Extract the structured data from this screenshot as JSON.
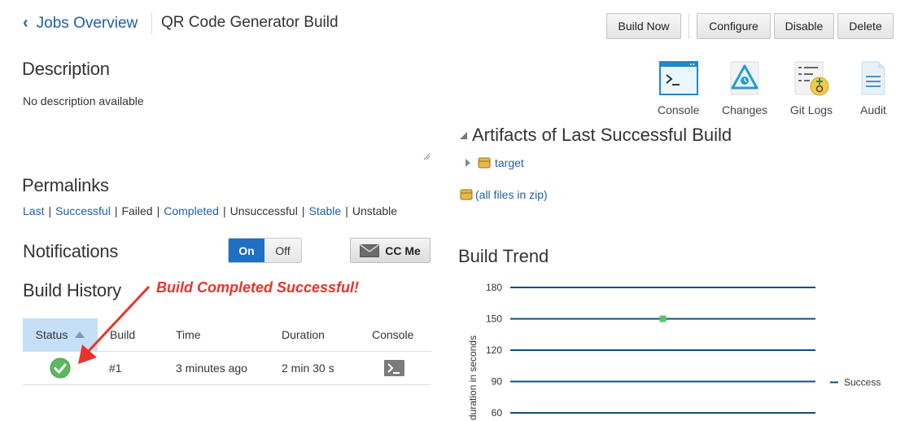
{
  "header": {
    "back_label": "Jobs Overview",
    "title": "QR Code Generator Build",
    "buttons": {
      "build_now": "Build Now",
      "configure": "Configure",
      "disable": "Disable",
      "delete": "Delete"
    }
  },
  "description": {
    "heading": "Description",
    "text": "No description available"
  },
  "permalinks": {
    "heading": "Permalinks",
    "items": [
      {
        "label": "Last",
        "link": true
      },
      {
        "label": "Successful",
        "link": true
      },
      {
        "label": "Failed",
        "link": false
      },
      {
        "label": "Completed",
        "link": true
      },
      {
        "label": "Unsuccessful",
        "link": false
      },
      {
        "label": "Stable",
        "link": true
      },
      {
        "label": "Unstable",
        "link": false
      }
    ]
  },
  "notifications": {
    "heading": "Notifications",
    "on_label": "On",
    "off_label": "Off",
    "selected": "On",
    "cc_me_label": "CC Me"
  },
  "build_history": {
    "heading": "Build History",
    "annotation": "Build Completed Successful!",
    "columns": [
      "Status",
      "Build",
      "Time",
      "Duration",
      "Console"
    ],
    "rows": [
      {
        "status": "success",
        "build": "#1",
        "time": "3 minutes ago",
        "duration": "2 min 30 s"
      }
    ]
  },
  "toolbar_icons": {
    "console": "Console",
    "changes": "Changes",
    "git_logs": "Git Logs",
    "audit": "Audit"
  },
  "artifacts": {
    "heading": "Artifacts of Last Successful Build",
    "folder": "target",
    "zip_link": "(all files in zip)"
  },
  "build_trend": {
    "heading": "Build Trend"
  },
  "chart_data": {
    "type": "line",
    "ylabel": "duration in seconds",
    "y_ticks": [
      180,
      150,
      120,
      90,
      60
    ],
    "series": [
      {
        "name": "Success",
        "points": [
          {
            "build": 1,
            "y": 150
          }
        ],
        "color": "#5cc06b"
      }
    ],
    "line_color": "#0f4f7a",
    "legend_position": "right"
  },
  "colors": {
    "link": "#1f5fa8",
    "accent": "#1f6fc2",
    "annotation": "#e8342a",
    "success": "#5cb85c"
  }
}
